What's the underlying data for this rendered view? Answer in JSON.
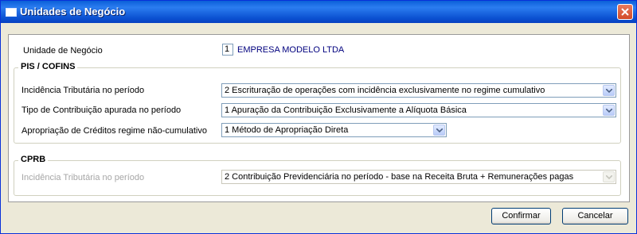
{
  "window": {
    "title": "Unidades de Negócio"
  },
  "unit": {
    "label": "Unidade de Negócio",
    "code": "1",
    "company": "EMPRESA MODELO LTDA"
  },
  "pis_cofins": {
    "legend": "PIS / COFINS",
    "fields": [
      {
        "label": "Incidência Tributária no período",
        "value": "2 Escrituração de operações com incidência exclusivamente no regime cumulativo"
      },
      {
        "label": "Tipo de Contribuição apurada no período",
        "value": "1 Apuração da Contribuição Exclusivamente a Alíquota Básica"
      },
      {
        "label": "Apropriação de Créditos regime não-cumulativo",
        "value": "1 Método de Apropriação Direta"
      }
    ]
  },
  "cprb": {
    "legend": "CPRB",
    "field": {
      "label": "Incidência Tributária no período",
      "value": "2 Contribuição Previdenciária no período - base na Receita Bruta + Remunerações pagas"
    }
  },
  "buttons": {
    "confirm": "Confirmar",
    "cancel": "Cancelar"
  }
}
